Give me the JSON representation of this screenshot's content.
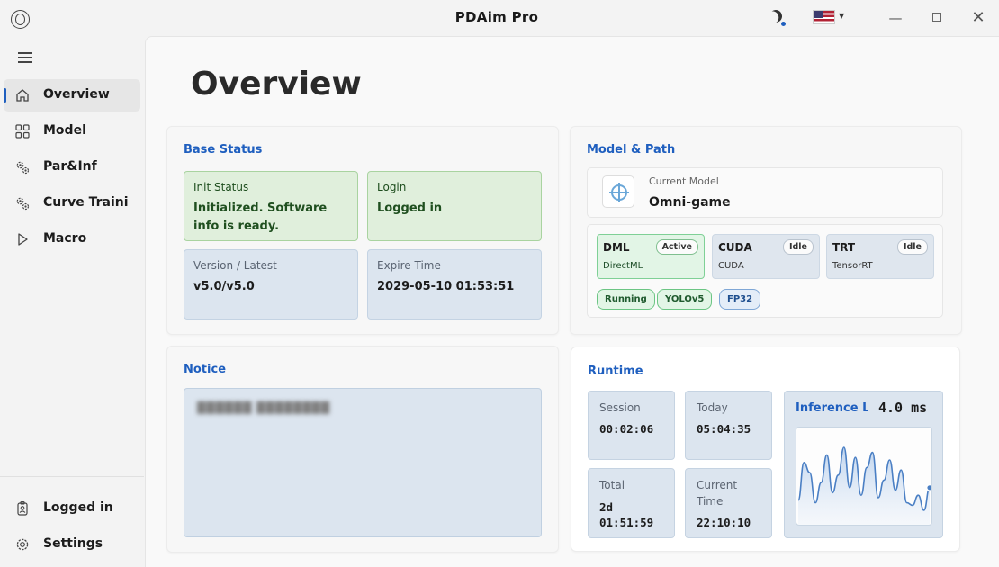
{
  "window": {
    "title": "PDAim  Pro",
    "icons": {
      "app": "app-logo-icon",
      "theme": "moon-icon",
      "language": "us-flag-icon",
      "minimize": "minimize-icon",
      "maximize": "maximize-icon",
      "close": "close-icon"
    }
  },
  "sidebar": {
    "items": [
      {
        "label": "Overview",
        "icon": "home-icon",
        "active": true
      },
      {
        "label": "Model",
        "icon": "grid-icon"
      },
      {
        "label": "Par&Inf",
        "icon": "gears-icon"
      },
      {
        "label": "Curve Traini",
        "icon": "gears-icon"
      },
      {
        "label": "Macro",
        "icon": "play-icon"
      }
    ],
    "footer": [
      {
        "label": "Logged in",
        "icon": "badge-icon"
      },
      {
        "label": "Settings",
        "icon": "settings-icon"
      }
    ]
  },
  "page": {
    "title": "Overview"
  },
  "base_status": {
    "title": "Base  Status",
    "init": {
      "label": "Init Status",
      "value": "Initialized. Software info is ready."
    },
    "login": {
      "label": "Login",
      "value": "Logged  in"
    },
    "version": {
      "label": "Version  /  Latest",
      "value": "v5.0/v5.0"
    },
    "expire": {
      "label": "Expire Time",
      "value": "2029-05-10  01:53:51"
    }
  },
  "model_path": {
    "title": "Model  &  Path",
    "current_label": "Current  Model",
    "current_value": "Omni-game",
    "backends": [
      {
        "name": "DML",
        "sub": "DirectML",
        "status": "Active"
      },
      {
        "name": "CUDA",
        "sub": "CUDA",
        "status": "Idle"
      },
      {
        "name": "TRT",
        "sub": "TensorRT",
        "status": "Idle"
      }
    ],
    "pills": [
      "Running",
      "YOLOv5",
      "FP32"
    ]
  },
  "notice": {
    "title": "Notice",
    "text": "██████  ████████"
  },
  "runtime": {
    "title": "Runtime",
    "session": {
      "label": "Session",
      "value": "00:02:06"
    },
    "today": {
      "label": "Today",
      "value": "05:04:35"
    },
    "total": {
      "label": "Total",
      "value_line1": "2d",
      "value_line2": "01:51:59"
    },
    "current": {
      "label_line1": "Current",
      "label_line2": "Time",
      "value": "22:10:10"
    },
    "latency": {
      "label": "Inference  Latency",
      "value": "4.0  ms"
    }
  },
  "chart_data": {
    "type": "area",
    "title": "Inference Latency",
    "y": [
      3.1,
      4.6,
      4.2,
      3.0,
      3.8,
      4.9,
      3.4,
      4.1,
      5.2,
      3.6,
      4.8,
      3.3,
      4.4,
      5.0,
      3.2,
      3.9,
      4.7,
      3.5,
      4.3,
      3.0,
      2.9,
      3.3,
      2.7,
      3.6
    ],
    "color": "#4a7fc4",
    "grid": false
  }
}
